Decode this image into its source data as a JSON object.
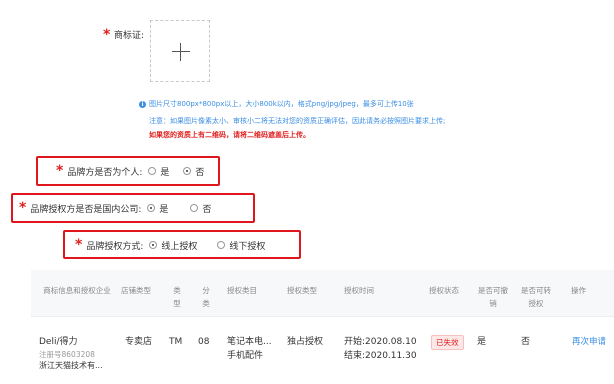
{
  "trademark": {
    "required_mark": "*",
    "label": "商标证:"
  },
  "notes": {
    "line1": "图片尺寸800px*800px以上，大小800k以内，格式png/jpg/jpeg，最多可上传10张",
    "line2": "注意：如果图片像素太小、审核小二将无法对您的资质正确评估，因此请务必按照图片要求上传;",
    "line3": "如果您的资质上有二维码，请将二维码遮盖后上传。"
  },
  "brand_personal": {
    "label": "品牌方是否为个人:",
    "options": [
      "是",
      "否"
    ],
    "selected": "否"
  },
  "domestic_company": {
    "label": "品牌授权方是否是国内公司:",
    "options": [
      "是",
      "否"
    ],
    "selected": "是"
  },
  "auth_method": {
    "label": "品牌授权方式:",
    "options": [
      "线上授权",
      "线下授权"
    ],
    "selected": "线上授权"
  },
  "table": {
    "headers": [
      "商标信息和授权企业",
      "店铺类型",
      "类型",
      "分类",
      "授权类目",
      "授权类型",
      "授权时间",
      "授权状态",
      "是否可撤销",
      "是否可转授权",
      "操作"
    ],
    "row": {
      "brand": "Deli/得力",
      "reg_no": "注册号8603208",
      "company": "浙江天猫技术有...",
      "shop_type": "专卖店",
      "type": "TM",
      "category": "08",
      "auth_category_1": "笔记本电...",
      "auth_category_2": "手机配件",
      "auth_type": "独占授权",
      "start": "开始:2020.08.10",
      "end": "结束:2020.11.30",
      "status": "已失效",
      "revocable": "是",
      "transferable": "否",
      "action": "再次申请"
    }
  },
  "colors": {
    "required": "#e02020",
    "highlight": "#e0161d",
    "link": "#3a8ee6"
  }
}
